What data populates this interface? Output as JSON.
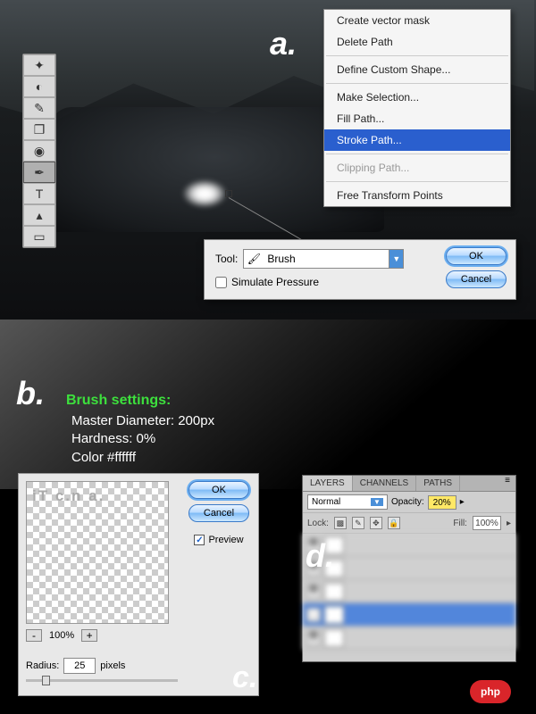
{
  "labels": {
    "a": "a.",
    "b": "b.",
    "c": "c.",
    "d": "d."
  },
  "context_menu": {
    "create_vector_mask": "Create vector mask",
    "delete_path": "Delete Path",
    "define_custom_shape": "Define Custom Shape...",
    "make_selection": "Make Selection...",
    "fill_path": "Fill Path...",
    "stroke_path": "Stroke Path...",
    "clipping_path": "Clipping Path...",
    "free_transform": "Free Transform Points"
  },
  "stroke_dialog": {
    "tool_label": "Tool:",
    "tool_value": "Brush",
    "simulate_pressure": "Simulate Pressure",
    "ok": "OK",
    "cancel": "Cancel"
  },
  "brush_settings": {
    "title": "Brush settings:",
    "diameter": "Master Diameter: 200px",
    "hardness": "Hardness: 0%",
    "color": "Color #ffffff"
  },
  "gaussian": {
    "watermark": "iT c.n a.",
    "zoom": "100%",
    "radius_label": "Radius:",
    "radius_value": "25",
    "radius_unit": "pixels",
    "ok": "OK",
    "cancel": "Cancel",
    "preview": "Preview"
  },
  "layers_panel": {
    "tabs": {
      "layers": "LAYERS",
      "channels": "CHANNELS",
      "paths": "PATHS"
    },
    "blend": "Normal",
    "opacity_label": "Opacity:",
    "opacity_value": "20%",
    "lock_label": "Lock:",
    "fill_label": "Fill:",
    "fill_value": "100%"
  },
  "badge": "php"
}
